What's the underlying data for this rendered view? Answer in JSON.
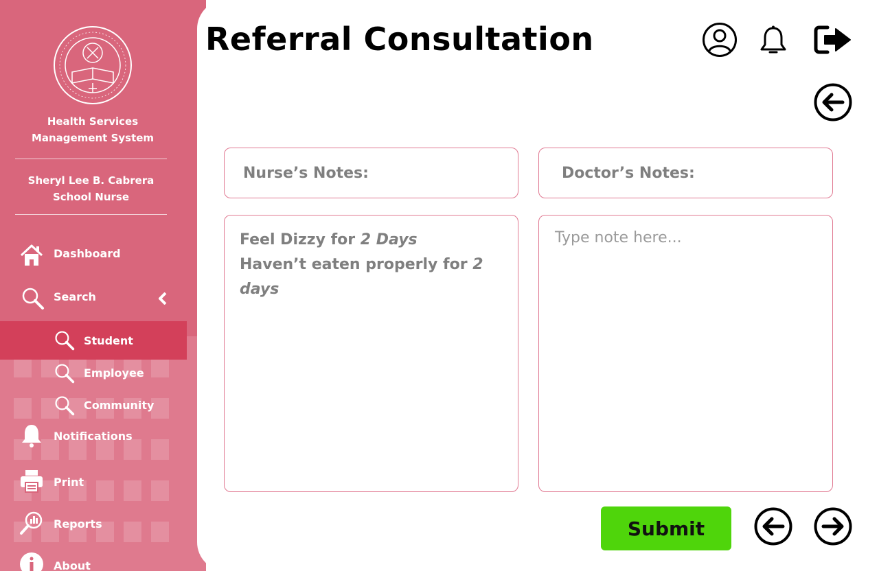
{
  "app": {
    "system_name_line1": "Health Services",
    "system_name_line2": "Management System",
    "user_name": "Sheryl Lee B. Cabrera",
    "user_role": "School Nurse",
    "logo_text": "UNIVERSITY OF THE IMMACULATE CONCEPTION · DAVAO · 1905 · CITY"
  },
  "sidebar": {
    "items": [
      {
        "label": "Dashboard",
        "icon": "home-icon"
      },
      {
        "label": "Search",
        "icon": "search-icon"
      },
      {
        "label": "Student",
        "icon": "search-icon",
        "active": true
      },
      {
        "label": "Employee",
        "icon": "search-icon"
      },
      {
        "label": "Community",
        "icon": "search-icon"
      },
      {
        "label": "Notifications",
        "icon": "bell-icon"
      },
      {
        "label": "Print",
        "icon": "printer-icon"
      },
      {
        "label": "Reports",
        "icon": "reports-icon"
      },
      {
        "label": "About",
        "icon": "info-icon"
      }
    ]
  },
  "header": {
    "title": "Referral Consultation"
  },
  "notes": {
    "nurse_label": "Nurse’s Notes:",
    "doctor_label": "Doctor’s Notes:",
    "nurse_text": {
      "line1_a": "Feel Dizzy for ",
      "line1_b": "2 Days",
      "line2_a": "Haven’t eaten properly for ",
      "line2_b": "2 days"
    },
    "doctor_placeholder": "Type note here..."
  },
  "actions": {
    "submit_label": "Submit"
  },
  "colors": {
    "sidebar": "#d9667c",
    "active_item": "#d3405a",
    "border": "#e07891",
    "submit": "#4fd50b"
  }
}
